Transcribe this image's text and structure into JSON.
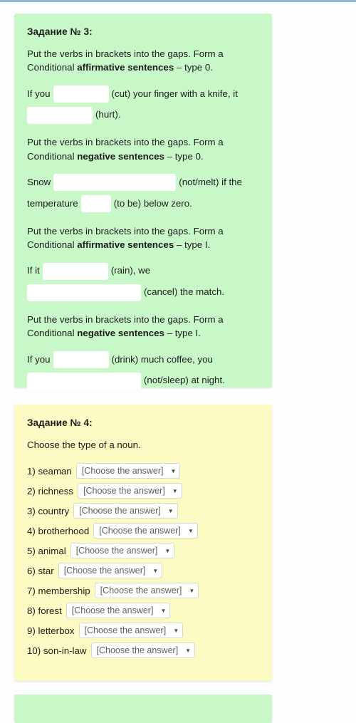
{
  "page": {
    "background": "#fdfdfd",
    "top_bar_color": "#8fbcd4"
  },
  "cards": {
    "task3": {
      "title": "Задание № 3:",
      "background": "#c8f7c8",
      "blocks": [
        {
          "instruction_pre": "Put the verbs in brackets into the gaps. Form a Conditional ",
          "instruction_bold": "affirmative sentences",
          "instruction_post": " – type 0.",
          "parts": {
            "p1": "If you",
            "p2": "(cut) your finger with a knife, it",
            "p3": "(hurt)."
          }
        },
        {
          "instruction_pre": "Put the verbs in brackets into the gaps. Form a Conditional ",
          "instruction_bold": "negative sentences",
          "instruction_post": " – type 0.",
          "parts": {
            "p1": "Snow",
            "p2": "(not/melt) if the temperature",
            "p3": "(to be) below zero."
          }
        },
        {
          "instruction_pre": "Put the verbs in brackets into the gaps. Form a Conditional ",
          "instruction_bold": "affirmative sentences",
          "instruction_post": " – type I.",
          "parts": {
            "p1": "If it",
            "p2": "(rain), we",
            "p3": "(cancel) the match."
          }
        },
        {
          "instruction_pre": "Put the verbs in brackets into the gaps. Form a Conditional ",
          "instruction_bold": "negative sentences",
          "instruction_post": " – type I.",
          "parts": {
            "p1": "If you",
            "p2": "(drink) much coffee, you",
            "p3": "(not/sleep) at night."
          }
        }
      ],
      "input_values": [
        "",
        "",
        "",
        "",
        "",
        "",
        "",
        ""
      ],
      "input_placeholder": ""
    },
    "task4": {
      "title": "Задание № 4:",
      "background": "#fbfbc3",
      "instruction": "Choose the type of a noun.",
      "select_label": "[Choose the answer]",
      "caret_icon": "▼",
      "items": [
        {
          "label": "1) seaman",
          "value": "[Choose the answer]"
        },
        {
          "label": "2) richness",
          "value": "[Choose the answer]"
        },
        {
          "label": "3) country",
          "value": "[Choose the answer]"
        },
        {
          "label": "4) brotherhood",
          "value": "[Choose the answer]"
        },
        {
          "label": "5) animal",
          "value": "[Choose the answer]"
        },
        {
          "label": "6) star",
          "value": "[Choose the answer]"
        },
        {
          "label": "7) membership",
          "value": "[Choose the answer]"
        },
        {
          "label": "8) forest",
          "value": "[Choose the answer]"
        },
        {
          "label": "9) letterbox",
          "value": "[Choose the answer]"
        },
        {
          "label": "10) son-in-law",
          "value": "[Choose the answer]"
        }
      ]
    },
    "task5_partial": {
      "background": "#c8f7c8"
    }
  }
}
